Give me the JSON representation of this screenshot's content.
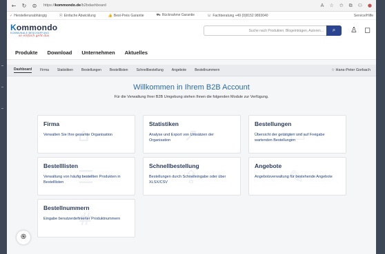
{
  "browser": {
    "url_prefix": "https://",
    "url_host": "kommondo.de",
    "url_path": "/b2bdashboard",
    "icons": [
      "back-icon",
      "reload-icon",
      "lock-icon",
      "read-aloud-icon",
      "star-icon",
      "favorites-icon",
      "collections-icon",
      "extension-icon",
      "profile-icon"
    ]
  },
  "infobar": {
    "items": [
      {
        "icon": "✓",
        "label": "Herstellerunabhängig"
      },
      {
        "icon": "⦿",
        "label": "Einfache Abwicklung"
      },
      {
        "icon": "👍",
        "label": "Best-Preis Garantie"
      },
      {
        "icon": "⛟",
        "label": "Rücknahme Garantie"
      },
      {
        "icon": "☏",
        "label": "Fachberatung +49 (0)8152 9893040"
      }
    ],
    "service": "Service/Hilfe"
  },
  "header": {
    "brand_k": "K",
    "brand_rest": "ommondo",
    "brand_sub": "KOMMUNALE BESCHAFFUNG",
    "tagline": "so einfach geht das",
    "search_placeholder": "Suche nach Produkten, Blogeinträgen, Autoren...",
    "search_icon": "⌕",
    "account_icon": "♙",
    "cart_icon": "◻"
  },
  "mainnav": [
    "Produkte",
    "Download",
    "Unternehmen",
    "Aktuelles"
  ],
  "subnav": {
    "tabs": [
      "Dashboard",
      "Firma",
      "Statistiken",
      "Bestellungen",
      "Bestelllisten",
      "Schnellbestellung",
      "Angebote",
      "Bestellnummern"
    ],
    "user_icon": "☆",
    "user": "Hans-Peter Gorbach"
  },
  "welcome": {
    "title": "Willkommen in Ihrem B2B Account",
    "subtitle": "Für die Verwaltung Ihrer B2B Umgebung stehen Ihnen die folgenden Module zur Verfügung."
  },
  "cards": [
    {
      "title": "Firma",
      "desc": "Verwalten Sie Ihre gesamte Organisation",
      "wm": "⌂"
    },
    {
      "title": "Statistiken",
      "desc": "Analyse und Export von Umsätzen der Organisation",
      "wm": "↗"
    },
    {
      "title": "Bestellungen",
      "desc": "Übersicht der getätigten und auf Freigabe wartenden Bestellungen",
      "wm": "▭"
    },
    {
      "title": "Bestelllisten",
      "desc": "Verwaltung von häufig bestellten Produkten in Bestelllisten",
      "wm": "☰"
    },
    {
      "title": "Schnellbestellung",
      "desc": "Bestellungen durch Schnelleingabe oder über XLSX/CSV",
      "wm": "⇪"
    },
    {
      "title": "Angebote",
      "desc": "Angebotsverwaltung für bestehende Angebote",
      "wm": "✎"
    },
    {
      "title": "Bestellnummern",
      "desc": "Eingabe benutzerdefinierter Produktnummern",
      "wm": "#"
    }
  ],
  "fingerprint_icon": "֍"
}
